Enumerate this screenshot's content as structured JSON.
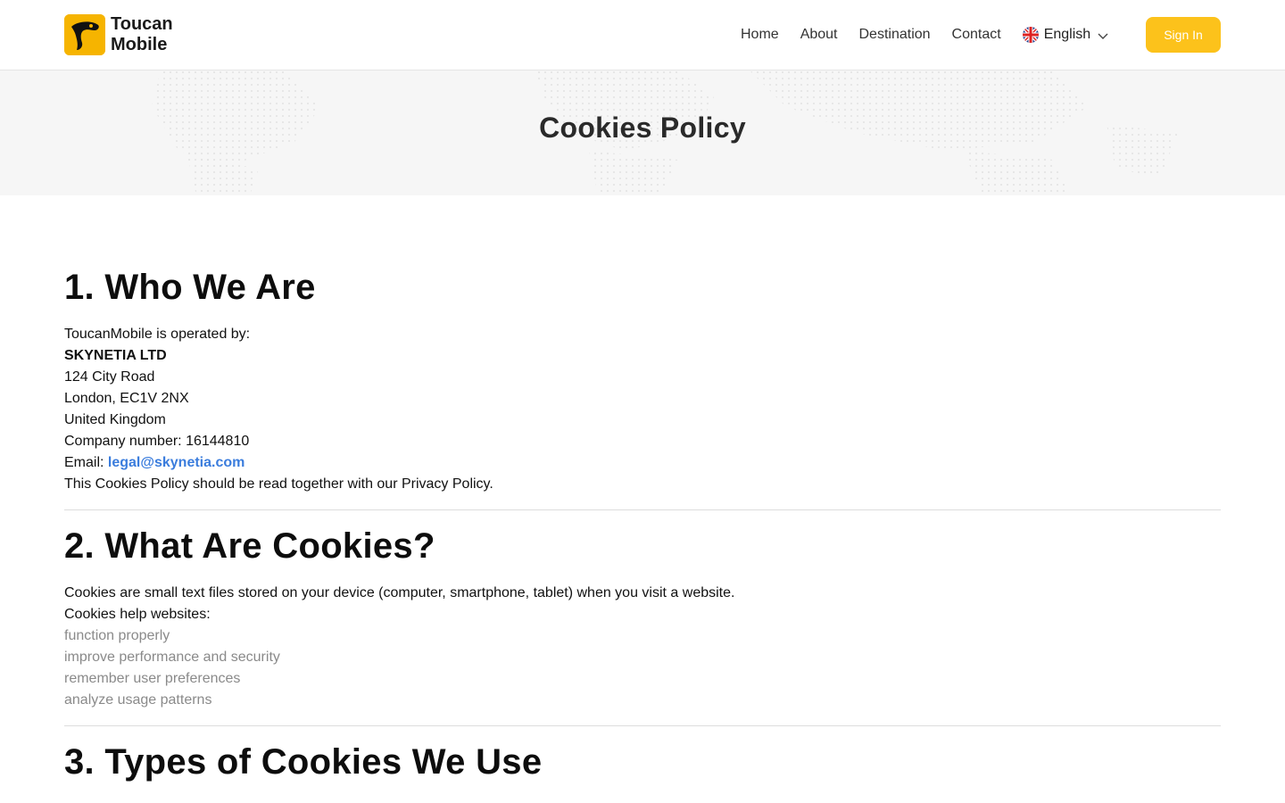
{
  "header": {
    "logo_line1": "Toucan",
    "logo_line2": "Mobile",
    "nav": [
      "Home",
      "About",
      "Destination",
      "Contact"
    ],
    "language": "English",
    "sign_in": "Sign In",
    "accent_color": "#fcc21b"
  },
  "hero": {
    "title": "Cookies Policy"
  },
  "sections": {
    "s1": {
      "title": "1. Who We Are",
      "operated_by": "ToucanMobile is operated by:",
      "company": "SKYNETIA LTD",
      "address1": "124 City Road",
      "address2": "London, EC1V 2NX",
      "country": "United Kingdom",
      "company_number": "Company number: 16144810",
      "email_label": "Email: ",
      "email": "legal@skynetia.com",
      "note": "This Cookies Policy should be read together with our Privacy Policy."
    },
    "s2": {
      "title": "2. What Are Cookies?",
      "line1": "Cookies are small text files stored on your device (computer, smartphone, tablet) when you visit a website.",
      "line2": "Cookies help websites:",
      "items": [
        "function properly",
        "improve performance and security",
        "remember user preferences",
        "analyze usage patterns"
      ]
    },
    "s3": {
      "title": "3. Types of Cookies We Use"
    }
  }
}
